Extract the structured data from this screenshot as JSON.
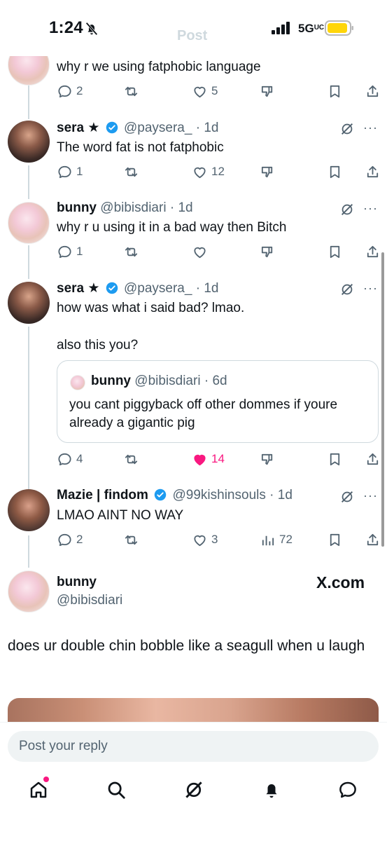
{
  "status_bar": {
    "time": "1:24",
    "network": "5G",
    "ghost_title": "Post"
  },
  "tweets": [
    {
      "body": "why r we using fatphobic language",
      "actions": {
        "replies": "2",
        "reposts": "",
        "likes": "5"
      }
    },
    {
      "name": "sera ★",
      "handle": "@paysera_",
      "time": "· 1d",
      "body": "The word fat is not fatphobic",
      "actions": {
        "replies": "1",
        "reposts": "",
        "likes": "12"
      }
    },
    {
      "name": "bunny",
      "handle": "@bibisdiari",
      "time": "· 1d",
      "body": "why r u using it in a bad way then Bitch",
      "actions": {
        "replies": "1",
        "reposts": "",
        "likes": ""
      }
    },
    {
      "name": "sera ★",
      "handle": "@paysera_",
      "time": "· 1d",
      "body_line1": "how was what i said bad? lmao.",
      "body_line2": "also this you?",
      "quote": {
        "name": "bunny",
        "handle": "@bibisdiari",
        "time": "· 6d",
        "body": "you cant piggyback off other dommes if youre already a gigantic pig"
      },
      "actions": {
        "replies": "4",
        "reposts": "",
        "likes": "14"
      }
    },
    {
      "name": "Mazie | findom",
      "handle": "@99kishinsouls",
      "time": "· 1d",
      "body": "LMAO AINT NO WAY",
      "actions": {
        "replies": "2",
        "reposts": "",
        "likes": "3",
        "views": "72"
      }
    }
  ],
  "focused": {
    "name": "bunny",
    "handle": "@bibisdiari",
    "source": "X.com",
    "body": "does ur double chin bobble like a seagull when u laugh"
  },
  "reply": {
    "placeholder": "Post your reply"
  },
  "colors": {
    "like_active": "#f91880",
    "verified": "#1d9bf0",
    "muted": "#536471",
    "battery": "#ffd60a"
  },
  "nav": [
    "home-icon",
    "search-icon",
    "grok-icon",
    "notifications-icon",
    "messages-icon"
  ]
}
